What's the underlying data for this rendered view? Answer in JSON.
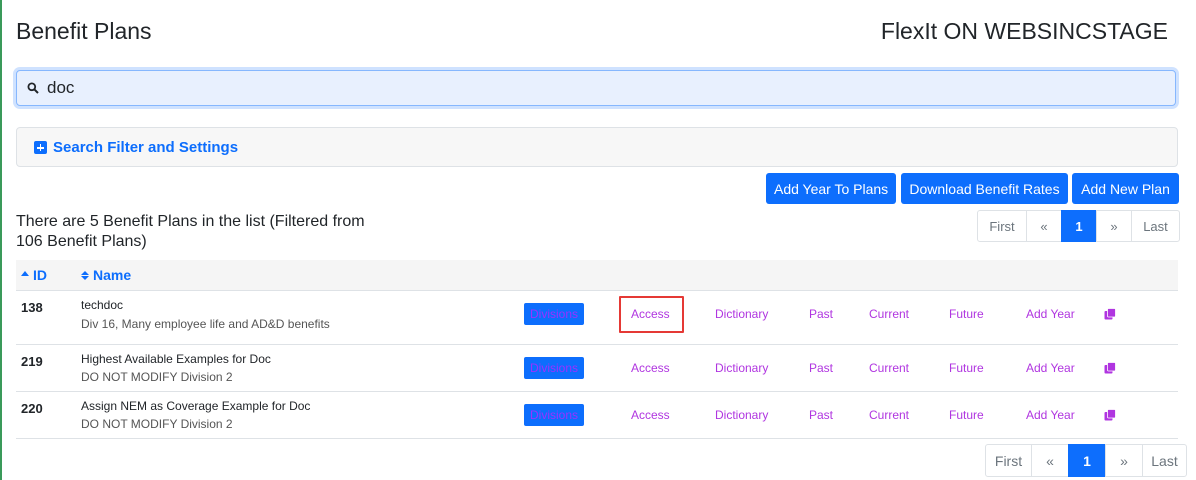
{
  "header": {
    "page_title": "Benefit Plans",
    "app_title": "FlexIt ON WEBSINCSTAGE"
  },
  "search": {
    "value": "doc",
    "icon": "search-icon"
  },
  "filter": {
    "label": "Search Filter and Settings",
    "icon": "plus-square-icon"
  },
  "actions": {
    "add_year": "Add Year To Plans",
    "download_rates": "Download Benefit Rates",
    "add_plan": "Add New Plan"
  },
  "summary": {
    "count_text": "There are 5 Benefit Plans in the list (Filtered from 106 Benefit Plans)"
  },
  "pager_top": {
    "first": "First",
    "prev": "«",
    "page": "1",
    "next": "»",
    "last": "Last"
  },
  "pager_bottom": {
    "first": "First",
    "prev": "«",
    "page": "1",
    "next": "»",
    "last": "Last"
  },
  "table": {
    "col_id": "ID",
    "col_name": "Name",
    "rows": [
      {
        "id": "138",
        "name": "techdoc",
        "desc": "Div 16, Many employee life and AD&D benefits",
        "divisions": "Divisions",
        "access": "Access",
        "dictionary": "Dictionary",
        "past": "Past",
        "current": "Current",
        "future": "Future",
        "add_year": "Add Year"
      },
      {
        "id": "219",
        "name": "Highest Available Examples for Doc",
        "desc": "DO NOT MODIFY Division 2",
        "divisions": "Divisions",
        "access": "Access",
        "dictionary": "Dictionary",
        "past": "Past",
        "current": "Current",
        "future": "Future",
        "add_year": "Add Year"
      },
      {
        "id": "220",
        "name": "Assign NEM as Coverage Example for Doc",
        "desc": "DO NOT MODIFY Division 2",
        "divisions": "Divisions",
        "access": "Access",
        "dictionary": "Dictionary",
        "past": "Past",
        "current": "Current",
        "future": "Future",
        "add_year": "Add Year"
      }
    ]
  },
  "colors": {
    "primary": "#0d6efd",
    "link_purple": "#b035e0",
    "highlight": "#e53935"
  }
}
